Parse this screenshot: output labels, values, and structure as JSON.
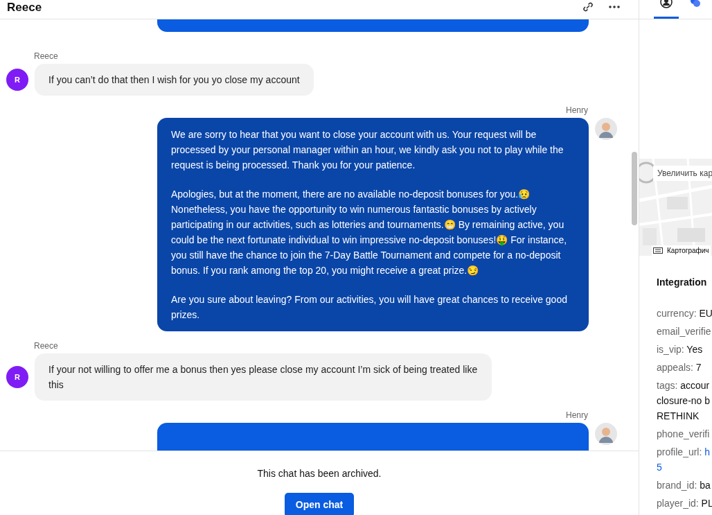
{
  "header": {
    "title": "Reece"
  },
  "messages": [
    {
      "kind": "agent"
    },
    {
      "kind": "customer",
      "sender": "Reece",
      "avatar": "R",
      "paragraphs": [
        "If you can’t do that then I wish for you yo close my account"
      ]
    },
    {
      "kind": "agent",
      "sender": "Henry",
      "paragraphs": [
        "We are sorry to hear that you want to close your account with us. Your request will be processed by your personal manager within an hour, we kindly ask you not to play while the request is being processed. Thank you for your patience.",
        "Apologies, but at the moment, there are no available no-deposit bonuses for you.😥 Nonetheless, you have the opportunity to win numerous fantastic bonuses by actively participating in our activities, such as lotteries and tournaments.😁 By remaining active, you could be the next fortunate individual to win impressive no-deposit bonuses!🤑 For instance, you still have the chance to join the 7-Day Battle Tournament and compete for a no-deposit bonus. If you rank among the top 20, you might receive a great prize.😏",
        "Are you sure about leaving? From our activities, you will have great chances to receive good prizes."
      ]
    },
    {
      "kind": "customer",
      "sender": "Reece",
      "avatar": "R",
      "paragraphs": [
        "If your not willing to offer me a bonus then yes please close my account I’m sick of being treated like this"
      ]
    },
    {
      "kind": "agent",
      "sender": "Henry"
    }
  ],
  "footer": {
    "notice": "This chat has been archived.",
    "button": "Open chat"
  },
  "side": {
    "tabs": [
      {
        "kind": "person",
        "selected": true
      },
      {
        "kind": "chat",
        "selected": false
      }
    ],
    "map": {
      "zoom_button": "Увеличить кар",
      "attribution": "Картографич"
    },
    "section_title": "Integration",
    "fields": [
      {
        "lines": [
          {
            "key": "currency: ",
            "value": "EU"
          }
        ]
      },
      {
        "lines": [
          {
            "key": "email_verifie"
          }
        ]
      },
      {
        "lines": [
          {
            "key": "is_vip: ",
            "value": "Yes"
          }
        ]
      },
      {
        "lines": [
          {
            "key": "appeals: ",
            "value": "7"
          }
        ]
      },
      {
        "lines": [
          {
            "key": "tags: ",
            "value": "accour"
          },
          {
            "value": "closure-no b"
          },
          {
            "value": "RETHINK"
          }
        ]
      },
      {
        "lines": [
          {
            "key": "phone_verifi"
          }
        ]
      },
      {
        "lines": [
          {
            "key": "profile_url: ",
            "link": "h"
          },
          {
            "link": "5"
          }
        ]
      },
      {
        "lines": [
          {
            "key": "brand_id: ",
            "value": "ba"
          }
        ]
      },
      {
        "lines": [
          {
            "key": "player_id: ",
            "value": "PL"
          }
        ]
      }
    ]
  }
}
